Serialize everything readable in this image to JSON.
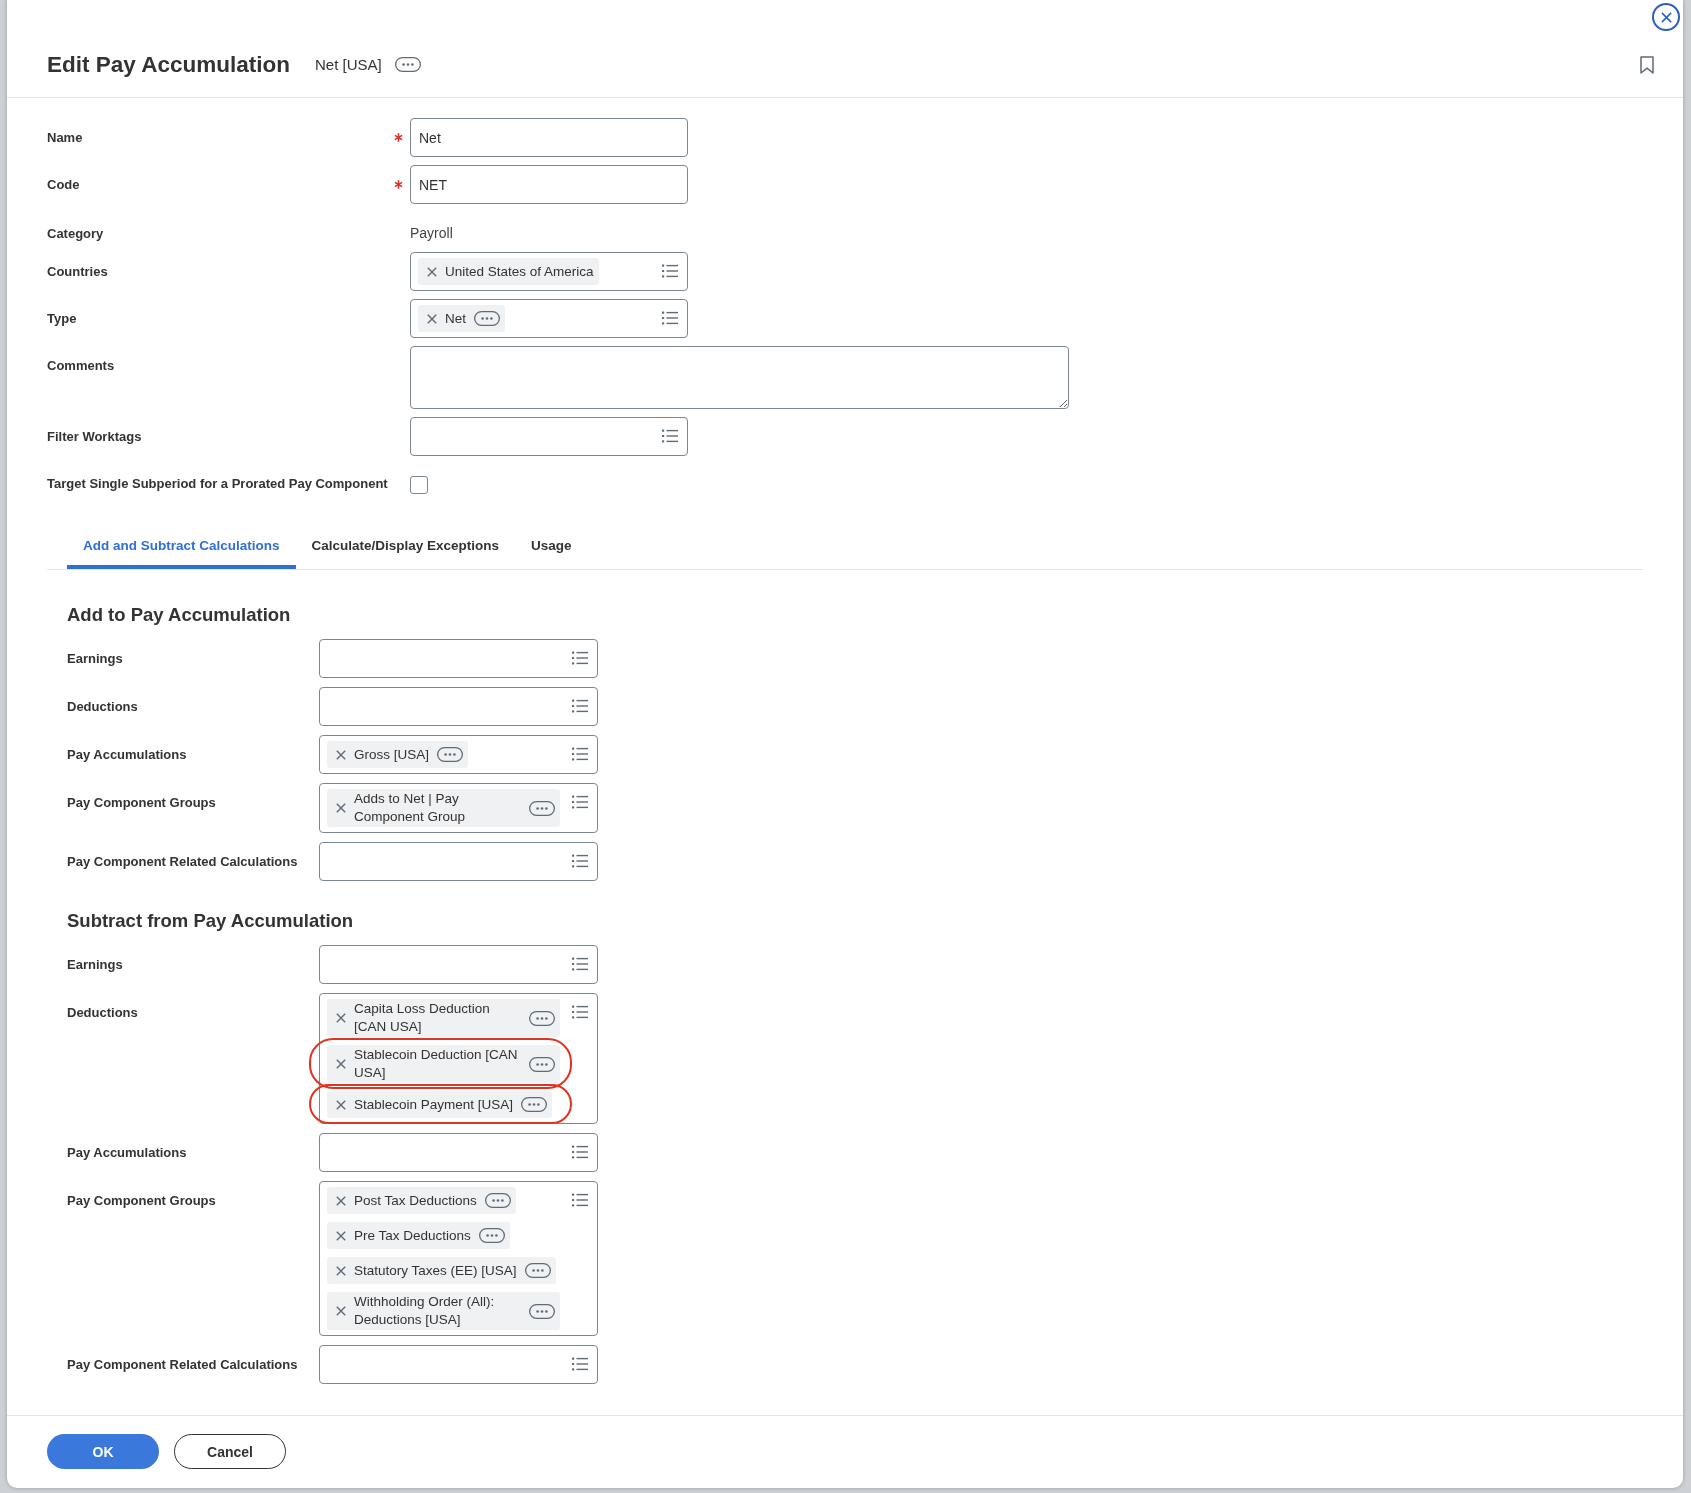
{
  "dialog": {
    "title": "Edit Pay Accumulation",
    "subtitle": "Net [USA]"
  },
  "fields": [
    {
      "kind": "text",
      "label": "Name",
      "required": true,
      "value": "Net"
    },
    {
      "kind": "text",
      "label": "Code",
      "required": true,
      "value": "NET"
    },
    {
      "kind": "static",
      "label": "Category",
      "required": false,
      "value": "Payroll"
    },
    {
      "kind": "multiselect",
      "label": "Countries",
      "required": false,
      "chips": [
        {
          "label": "United States of America",
          "has_menu": false,
          "circled": false
        }
      ]
    },
    {
      "kind": "multiselect",
      "label": "Type",
      "required": false,
      "chips": [
        {
          "label": "Net",
          "has_menu": true,
          "circled": false
        }
      ]
    },
    {
      "kind": "textarea",
      "label": "Comments",
      "required": false
    },
    {
      "kind": "multiselect",
      "label": "Filter Worktags",
      "required": false
    },
    {
      "kind": "checkbox",
      "label": "Target Single Subperiod for a Prorated Pay Component",
      "required": false,
      "checked": false
    }
  ],
  "tabs": [
    {
      "label": "Add and Subtract Calculations",
      "selected": true
    },
    {
      "label": "Calculate/Display Exceptions",
      "selected": false
    },
    {
      "label": "Usage",
      "selected": false
    }
  ],
  "sections": [
    {
      "title": "Add to Pay Accumulation",
      "fields": [
        {
          "label": "Earnings"
        },
        {
          "label": "Deductions"
        },
        {
          "label": "Pay Accumulations",
          "chips": [
            {
              "label": "Gross [USA]",
              "has_menu": true,
              "circled": false
            }
          ]
        },
        {
          "label": "Pay Component Groups",
          "chips": [
            {
              "label": "Adds to Net | Pay Component Group",
              "has_menu": true,
              "circled": false
            }
          ]
        },
        {
          "label": "Pay Component Related Calculations"
        }
      ]
    },
    {
      "title": "Subtract from Pay Accumulation",
      "fields": [
        {
          "label": "Earnings"
        },
        {
          "label": "Deductions",
          "chips": [
            {
              "label": "Capita Loss Deduction [CAN USA]",
              "has_menu": true,
              "circled": false
            },
            {
              "label": "Stablecoin Deduction [CAN USA]",
              "has_menu": true,
              "circled": true
            },
            {
              "label": "Stablecoin Payment [USA]",
              "has_menu": true,
              "circled": true
            }
          ]
        },
        {
          "label": "Pay Accumulations"
        },
        {
          "label": "Pay Component Groups",
          "chips": [
            {
              "label": "Post Tax Deductions",
              "has_menu": true,
              "circled": false
            },
            {
              "label": "Pre Tax Deductions",
              "has_menu": true,
              "circled": false
            },
            {
              "label": "Statutory Taxes (EE) [USA]",
              "has_menu": true,
              "circled": false
            },
            {
              "label": "Withholding Order (All): Deductions [USA]",
              "has_menu": true,
              "circled": false
            }
          ]
        },
        {
          "label": "Pay Component Related Calculations"
        }
      ]
    }
  ],
  "buttons": [
    {
      "label": "OK",
      "kind": "primary"
    },
    {
      "label": "Cancel",
      "kind": "secondary"
    }
  ]
}
